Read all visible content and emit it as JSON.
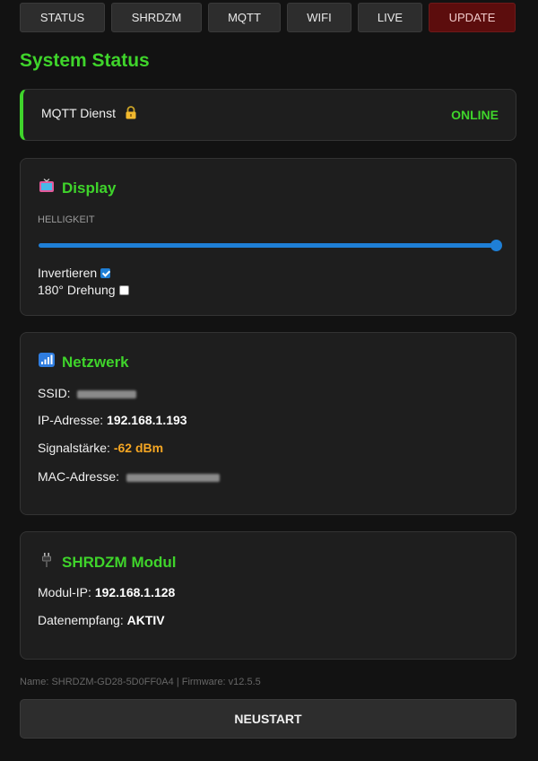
{
  "nav": {
    "items": [
      {
        "label": "STATUS"
      },
      {
        "label": "SHRDZM"
      },
      {
        "label": "MQTT"
      },
      {
        "label": "WIFI"
      },
      {
        "label": "LIVE"
      },
      {
        "label": "UPDATE"
      }
    ]
  },
  "page": {
    "title": "System Status"
  },
  "mqtt": {
    "label": "MQTT Dienst",
    "status": "ONLINE"
  },
  "display": {
    "title": "Display",
    "brightness_label": "HELLIGKEIT",
    "brightness_fraction": 1.0,
    "invert_label": "Invertieren",
    "invert_checked": true,
    "rotate_label": "180° Drehung",
    "rotate_checked": false
  },
  "network": {
    "title": "Netzwerk",
    "ssid_label": "SSID:",
    "ip_label": "IP-Adresse:",
    "ip_value": "192.168.1.193",
    "signal_label": "Signalstärke:",
    "signal_value": "-62 dBm",
    "mac_label": "MAC-Adresse:"
  },
  "module": {
    "title": "SHRDZM Modul",
    "ip_label": "Modul-IP:",
    "ip_value": "192.168.1.128",
    "rx_label": "Datenempfang:",
    "rx_value": "AKTIV"
  },
  "footer": {
    "info": "Name: SHRDZM-GD28-5D0FF0A4 | Firmware: v12.5.5",
    "restart_label": "NEUSTART"
  },
  "colors": {
    "accent": "#3fd42b",
    "slider": "#1f7fd6",
    "signal": "#f5a623",
    "update": "#5c0d0d"
  }
}
